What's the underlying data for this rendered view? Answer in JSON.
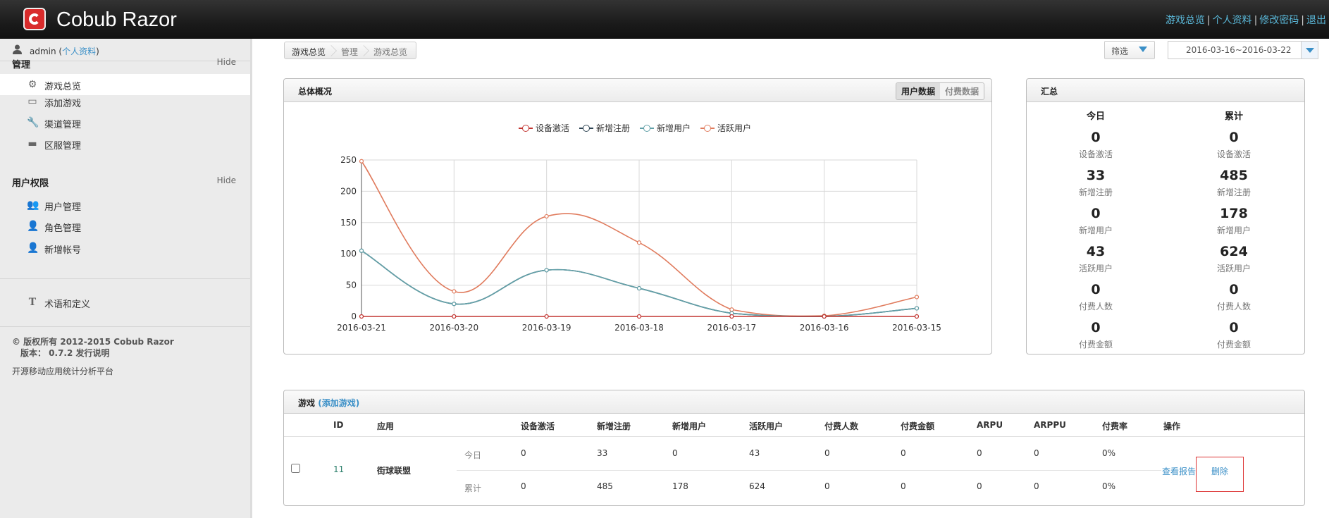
{
  "app": {
    "name": "Cobub Razor"
  },
  "top_links": [
    "游戏总览",
    "个人资料",
    "修改密码",
    "退出"
  ],
  "user": {
    "name": "admin",
    "profile_link": "个人资料"
  },
  "sidebar": {
    "section_manage": {
      "title": "管理",
      "hide": "Hide"
    },
    "manage_items": [
      {
        "label": "游戏总览",
        "icon": "gear-icon"
      },
      {
        "label": "添加游戏",
        "icon": "folder-icon"
      },
      {
        "label": "渠道管理",
        "icon": "wrench-icon"
      },
      {
        "label": "区服管理",
        "icon": "monitor-icon"
      }
    ],
    "section_perm": {
      "title": "用户权限",
      "hide": "Hide"
    },
    "perm_items": [
      {
        "label": "用户管理",
        "icon": "users-icon"
      },
      {
        "label": "角色管理",
        "icon": "role-icon"
      },
      {
        "label": "新增帐号",
        "icon": "user-icon"
      }
    ],
    "glossary": {
      "label": "术语和定义",
      "icon": "text-icon"
    },
    "copyright": "© 版权所有 2012-2015 Cobub Razor",
    "version": "版本： 0.7.2 发行说明",
    "tagline": "开源移动应用统计分析平台"
  },
  "breadcrumb": [
    "游戏总览",
    "管理",
    "游戏总览"
  ],
  "filter": {
    "label": "筛选"
  },
  "date_range": "2016-03-16~2016-03-22",
  "overview": {
    "title": "总体概况",
    "tabs": [
      "用户数据",
      "付费数据"
    ]
  },
  "chart_data": {
    "type": "line",
    "x": [
      "2016-03-21",
      "2016-03-20",
      "2016-03-19",
      "2016-03-18",
      "2016-03-17",
      "2016-03-16",
      "2016-03-15"
    ],
    "ylim": [
      0,
      250
    ],
    "yticks": [
      0,
      50,
      100,
      150,
      200,
      250
    ],
    "grid": true,
    "legend_position": "top",
    "series": [
      {
        "name": "设备激活",
        "color": "#c23531",
        "values": [
          0,
          0,
          0,
          0,
          0,
          0,
          0
        ]
      },
      {
        "name": "新增注册",
        "color": "#2f4554",
        "values": [
          105,
          20,
          74,
          45,
          5,
          0,
          13
        ]
      },
      {
        "name": "新增用户",
        "color": "#61a0a8",
        "values": [
          105,
          20,
          74,
          45,
          5,
          0,
          13
        ]
      },
      {
        "name": "活跃用户",
        "color": "#e07b5d",
        "values": [
          248,
          40,
          160,
          118,
          11,
          1,
          31
        ]
      }
    ]
  },
  "summary": {
    "title": "汇总",
    "col_today": "今日",
    "col_total": "累计",
    "rows": [
      {
        "label": "设备激活",
        "today": "0",
        "total": "0"
      },
      {
        "label": "新增注册",
        "today": "33",
        "total": "485"
      },
      {
        "label": "新增用户",
        "today": "0",
        "total": "178"
      },
      {
        "label": "活跃用户",
        "today": "43",
        "total": "624"
      },
      {
        "label": "付费人数",
        "today": "0",
        "total": "0"
      },
      {
        "label": "付费金额",
        "today": "0",
        "total": "0"
      }
    ]
  },
  "games": {
    "title": "游戏",
    "add_link": "(添加游戏)",
    "headers": [
      "ID",
      "应用",
      "设备激活",
      "新增注册",
      "新增用户",
      "活跃用户",
      "付费人数",
      "付费金额",
      "ARPU",
      "ARPPU",
      "付费率",
      "操作"
    ],
    "row": {
      "id": "11",
      "name": "街球联盟",
      "today_label": "今日",
      "total_label": "累计",
      "today": [
        "0",
        "33",
        "0",
        "43",
        "0",
        "0",
        "0",
        "0",
        "0%"
      ],
      "total": [
        "0",
        "485",
        "178",
        "624",
        "0",
        "0",
        "0",
        "0",
        "0%"
      ],
      "action_report": "查看报告",
      "action_delete": "删除"
    }
  }
}
